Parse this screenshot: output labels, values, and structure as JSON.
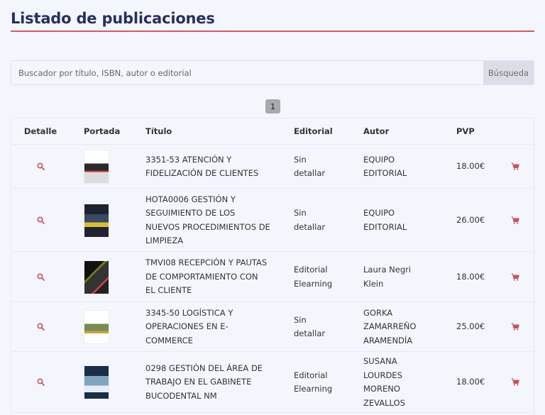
{
  "page": {
    "title": "Listado de publicaciones"
  },
  "search": {
    "placeholder": "Buscador por título, ISBN, autor o editorial",
    "button": "Búsqueda"
  },
  "pagination": {
    "current": "1"
  },
  "colors": {
    "accent": "#d65a60",
    "title": "#27305c",
    "icon": "#c9545a"
  },
  "table": {
    "headers": {
      "detalle": "Detalle",
      "portada": "Portada",
      "titulo": "Título",
      "editorial": "Editorial",
      "autor": "Autor",
      "pvp": "PVP"
    },
    "rows": [
      {
        "titulo": [
          "3351-53 ATENCIÓN Y",
          "FIDELIZACIÓN DE CLIENTES"
        ],
        "editorial": [
          "Sin",
          "detallar"
        ],
        "autor": [
          "EQUIPO",
          "EDITORIAL"
        ],
        "pvp": "18.00€",
        "detail_icon": "search-icon",
        "cart_icon": "cart-icon"
      },
      {
        "titulo": [
          "HOTA0006 GESTIÓN Y",
          "SEGUIMIENTO DE LOS",
          "NUEVOS PROCEDIMIENTOS DE",
          "LIMPIEZA"
        ],
        "editorial": [
          "Sin",
          "detallar"
        ],
        "autor": [
          "EQUIPO",
          "EDITORIAL"
        ],
        "pvp": "26.00€",
        "detail_icon": "search-icon",
        "cart_icon": "cart-icon"
      },
      {
        "titulo": [
          "TMVI08 RECEPCIÓN Y PAUTAS",
          "DE COMPORTAMIENTO CON",
          "EL CLIENTE"
        ],
        "editorial": [
          "Editorial",
          "Elearning"
        ],
        "autor": [
          "Laura Negri",
          "Klein"
        ],
        "pvp": "18.00€",
        "detail_icon": "search-icon",
        "cart_icon": "cart-icon"
      },
      {
        "titulo": [
          "3345-50 LOGÍSTICA Y",
          "OPERACIONES EN E-",
          "COMMERCE"
        ],
        "editorial": [
          "Sin",
          "detallar"
        ],
        "autor": [
          "GORKA",
          "ZAMARREÑO",
          "ARAMENDÍA"
        ],
        "pvp": "25.00€",
        "detail_icon": "search-icon",
        "cart_icon": "cart-icon"
      },
      {
        "titulo": [
          "0298 GESTIÓN DEL ÁREA DE",
          "TRABAJO EN EL GABINETE",
          "BUCODENTAL NM"
        ],
        "editorial": [
          "Editorial",
          "Elearning"
        ],
        "autor": [
          "SUSANA",
          "LOURDES",
          "MORENO",
          "ZEVALLOS"
        ],
        "pvp": "18.00€",
        "detail_icon": "search-icon",
        "cart_icon": "cart-icon"
      }
    ]
  }
}
